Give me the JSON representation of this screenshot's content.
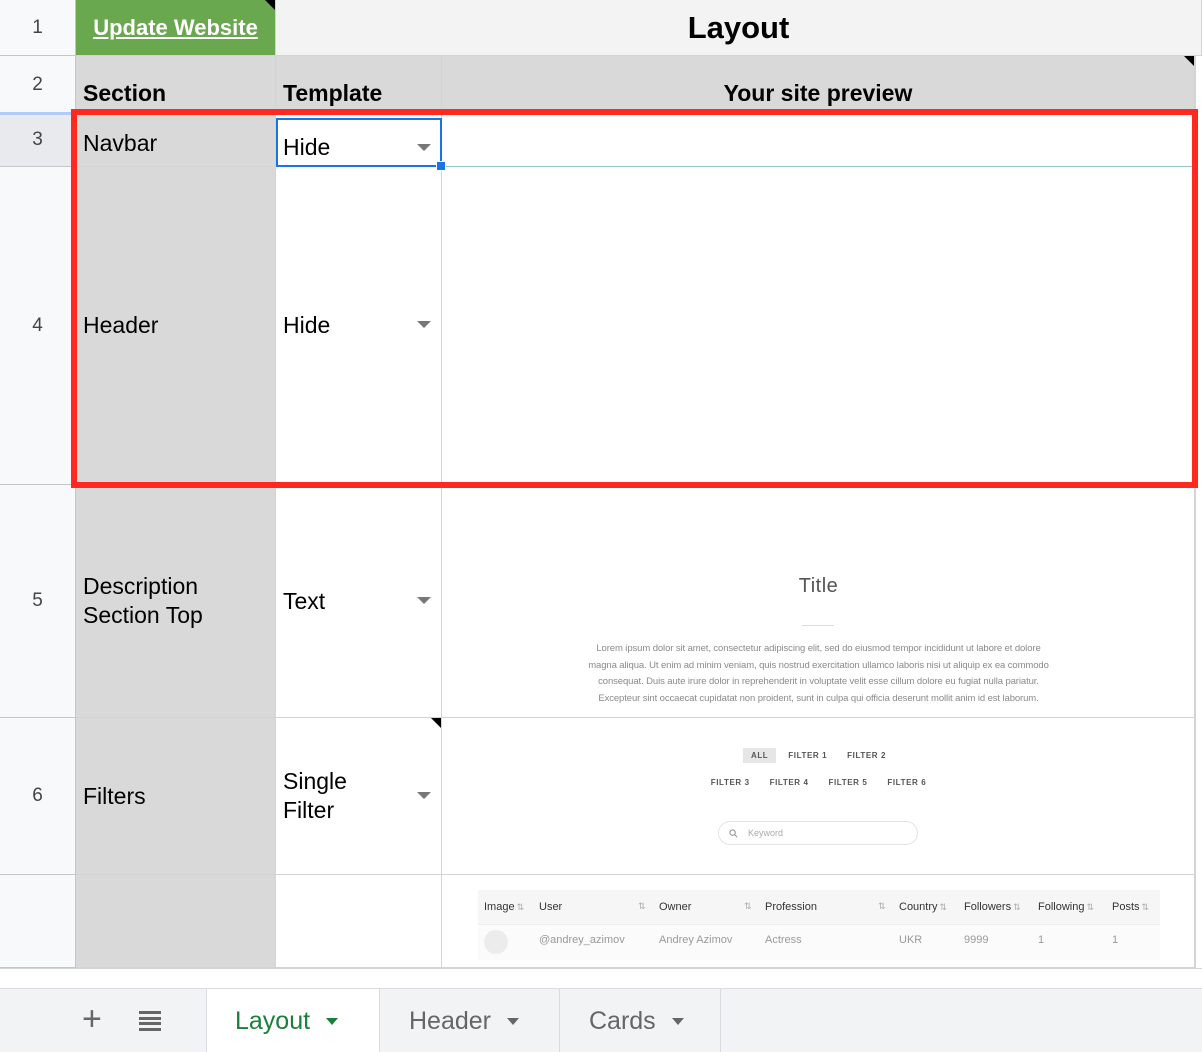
{
  "row_numbers": [
    "1",
    "2",
    "3",
    "4",
    "5",
    "6"
  ],
  "header_row": {
    "update_link": "Update Website",
    "layout_title": "Layout"
  },
  "columns": {
    "section": "Section",
    "template": "Template",
    "preview": "Your site preview"
  },
  "rows": [
    {
      "section": "Navbar",
      "template": "Hide"
    },
    {
      "section": "Header",
      "template": "Hide"
    },
    {
      "section": "Description Section Top",
      "template": "Text"
    },
    {
      "section": "Filters",
      "template": "Single Filter"
    }
  ],
  "preview": {
    "description": {
      "title": "Title",
      "body_lines": [
        "Lorem ipsum dolor sit amet, consectetur adipiscing elit, sed do eiusmod tempor incididunt ut labore et dolore",
        "magna aliqua. Ut enim ad minim veniam, quis nostrud exercitation ullamco laboris nisi ut aliquip ex ea commodo",
        "consequat. Duis aute irure dolor in reprehenderit in voluptate velit esse cillum dolore eu fugiat nulla pariatur.",
        "Excepteur sint occaecat cupidatat non proident, sunt in culpa qui officia deserunt mollit anim id est laborum."
      ]
    },
    "filters": {
      "row1": [
        "ALL",
        "FILTER 1",
        "FILTER 2"
      ],
      "row2": [
        "FILTER 3",
        "FILTER 4",
        "FILTER 5",
        "FILTER 6"
      ],
      "search_placeholder": "Keyword"
    },
    "table": {
      "headers": [
        "Image",
        "User",
        "Owner",
        "Profession",
        "Country",
        "Followers",
        "Following",
        "Posts"
      ],
      "row": [
        "@andrey_azimov",
        "Andrey Azimov",
        "Actress",
        "UKR",
        "9999",
        "1",
        "1"
      ]
    }
  },
  "sheet_tabs": {
    "add_label": "+",
    "tabs": [
      "Layout",
      "Header",
      "Cards"
    ],
    "active": "Layout"
  },
  "colors": {
    "update_button_bg": "#6aa84f",
    "highlight_border": "#ff2a1f",
    "active_tab_text": "#188038",
    "selection_blue": "#1a73e8"
  }
}
